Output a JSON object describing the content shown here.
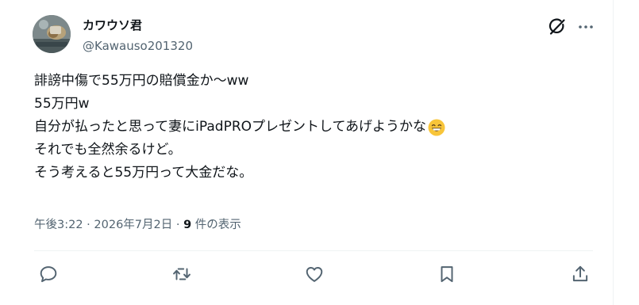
{
  "author": {
    "display_name": "カワウソ君",
    "handle": "@Kawauso201320"
  },
  "icons": {
    "header": [
      "grok-icon",
      "more-icon"
    ],
    "actions": [
      "reply-icon",
      "retweet-icon",
      "like-icon",
      "bookmark-icon",
      "share-icon"
    ]
  },
  "tweet": {
    "lines": [
      "誹謗中傷で55万円の賠償金か〜ww",
      "55万円w",
      "自分が払ったと思って妻にiPadPROプレゼントしてあげようかな",
      "それでも全然余るけど。",
      "そう考えると55万円って大金だな。"
    ],
    "emoji": "grinning-face"
  },
  "meta": {
    "time": "午後3:22",
    "separator": " · ",
    "date": "2026年7月2日",
    "views_count": "9",
    "views_label": " 件の表示"
  },
  "colors": {
    "text_primary": "#0f1419",
    "text_secondary": "#536471",
    "border": "#eff3f4"
  }
}
